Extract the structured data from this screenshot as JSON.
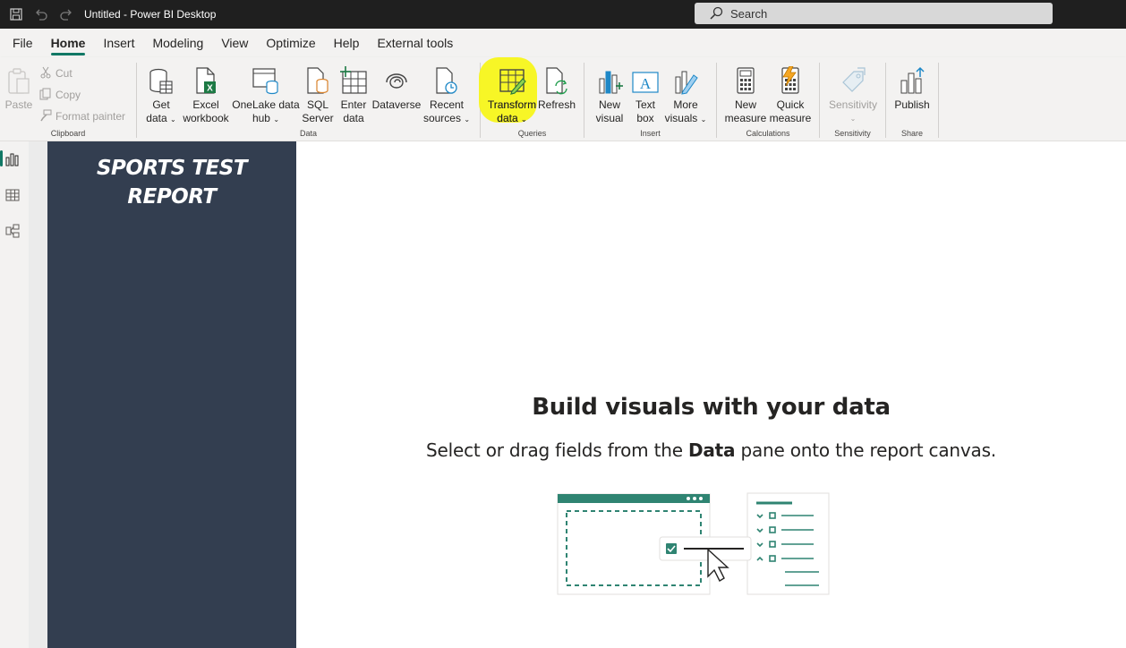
{
  "window": {
    "title": "Untitled - Power BI Desktop",
    "search_placeholder": "Search"
  },
  "menu": {
    "tabs": [
      "File",
      "Home",
      "Insert",
      "Modeling",
      "View",
      "Optimize",
      "Help",
      "External tools"
    ],
    "active": "Home"
  },
  "ribbon": {
    "clipboard": {
      "group_label": "Clipboard",
      "paste": "Paste",
      "cut": "Cut",
      "copy": "Copy",
      "format_painter": "Format painter"
    },
    "data": {
      "group_label": "Data",
      "get_data": [
        "Get",
        "data"
      ],
      "excel": [
        "Excel",
        "workbook"
      ],
      "onelake": [
        "OneLake data",
        "hub"
      ],
      "sql": [
        "SQL",
        "Server"
      ],
      "enter": [
        "Enter",
        "data"
      ],
      "dataverse": "Dataverse",
      "recent": [
        "Recent",
        "sources"
      ]
    },
    "queries": {
      "group_label": "Queries",
      "transform": [
        "Transform",
        "data"
      ],
      "refresh": "Refresh"
    },
    "insert": {
      "group_label": "Insert",
      "new_visual": [
        "New",
        "visual"
      ],
      "text_box": [
        "Text",
        "box"
      ],
      "more_visuals": [
        "More",
        "visuals"
      ]
    },
    "calculations": {
      "group_label": "Calculations",
      "new_measure": [
        "New",
        "measure"
      ],
      "quick_measure": [
        "Quick",
        "measure"
      ]
    },
    "sensitivity": {
      "group_label": "Sensitivity",
      "label": "Sensitivity"
    },
    "share": {
      "group_label": "Share",
      "publish": "Publish"
    }
  },
  "report": {
    "title_line1": "SPORTS TEST",
    "title_line2": "REPORT",
    "empty_title": "Build visuals with your data",
    "empty_sub_pre": "Select or drag fields from the ",
    "empty_sub_bold": "Data",
    "empty_sub_post": " pane onto the report canvas."
  },
  "colors": {
    "accent": "#117865",
    "panel": "#333e50",
    "highlight": "#f7f51a"
  }
}
